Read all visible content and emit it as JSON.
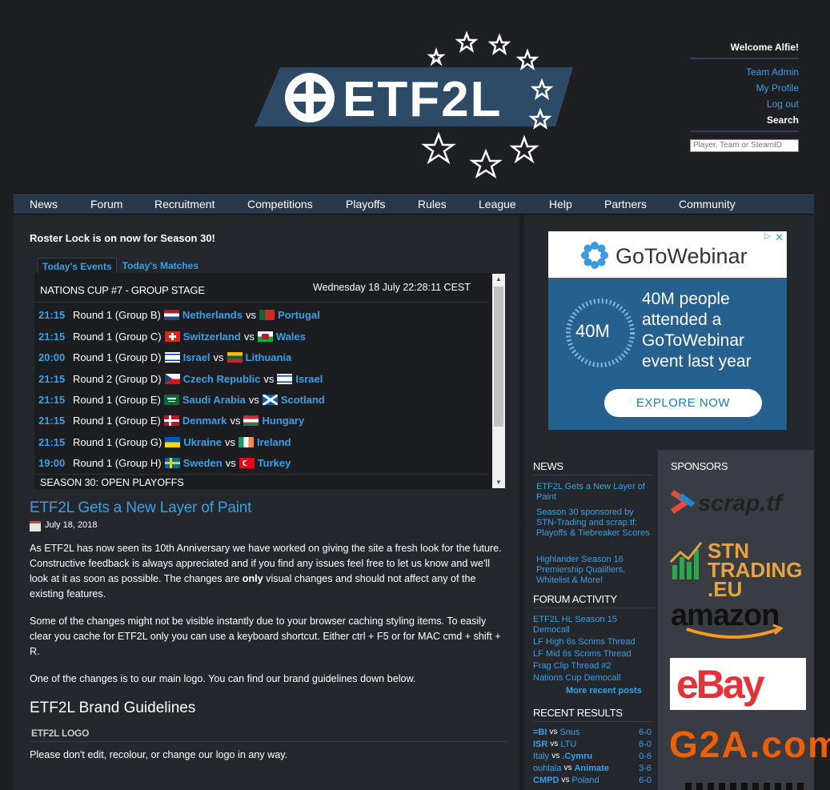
{
  "user": {
    "welcome": "Welcome Alfie!",
    "links": [
      "Team Admin",
      "My Profile",
      "Log out"
    ],
    "search_label": "Search",
    "search_placeholder": "Player, Team or SteamID"
  },
  "logo_text": "ETF2L",
  "nav": [
    "News",
    "Forum",
    "Recruitment",
    "Competitions",
    "Playoffs",
    "Rules",
    "League",
    "Help",
    "Partners",
    "Community"
  ],
  "announcement": "Roster Lock is on now for Season 30!",
  "tabs": [
    "Today's Events",
    "Today's Matches"
  ],
  "events": {
    "heading": "NATIONS CUP #7 - GROUP STAGE",
    "date": "Wednesday 18 July 22:28:11 CEST",
    "rows": [
      {
        "time": "21:15",
        "round": "Round 1 (Group B)",
        "team1": "Netherlands",
        "team2": "Portugal"
      },
      {
        "time": "21:15",
        "round": "Round 1 (Group C)",
        "team1": "Switzerland",
        "team2": "Wales"
      },
      {
        "time": "20:00",
        "round": "Round 1 (Group D)",
        "team1": "Israel",
        "team2": "Lithuania"
      },
      {
        "time": "21:15",
        "round": "Round 2 (Group D)",
        "team1": "Czech Republic",
        "team2": "Israel"
      },
      {
        "time": "21:15",
        "round": "Round 1 (Group E)",
        "team1": "Saudi Arabia",
        "team2": "Scotland"
      },
      {
        "time": "21:15",
        "round": "Round 1 (Group E)",
        "team1": "Denmark",
        "team2": "Hungary"
      },
      {
        "time": "21:15",
        "round": "Round 1 (Group G)",
        "team1": "Ukraine",
        "team2": "Ireland"
      },
      {
        "time": "19:00",
        "round": "Round 1 (Group H)",
        "team1": "Sweden",
        "team2": "Turkey"
      }
    ],
    "vs": "vs",
    "footer": "SEASON 30: OPEN PLAYOFFS"
  },
  "article": {
    "title": "ETF2L Gets a New Layer of Paint",
    "date": "July 18, 2018",
    "p1_a": "As ETF2L has now seen its 10th Anniversary we have worked on giving the site a fresh look for the future. Constructive feedback is always appreciated and if you find any issues feel free to let us know and we'll look at it as soon as possible. The changes are ",
    "p1_bold": "only",
    "p1_b": " visual changes and should not affect any of the existing features.",
    "p2": "Some of the changes might not be visible instantly due to your browser caching styling items. To easily clear you cache for ETF2L only you can use a keyboard shortcut. Either ctrl + F5 or for MAC cmd + shift + R.",
    "p3": "One of the changes is to our main logo. You can find our brand guidelines down below.",
    "brand_title": "ETF2L Brand Guidelines",
    "logo_sub": "ETF2L LOGO",
    "p4": "Please don't edit, recolour, or change our logo in any way."
  },
  "ad": {
    "brand": "GoToWebinar",
    "circle": "40M",
    "headline": "40M people attended a GoToWebinar event last year",
    "button": "EXPLORE NOW"
  },
  "news": {
    "heading": "NEWS",
    "items": [
      "ETF2L Gets a New Layer of Paint",
      "Season 30 sponsored by STN-Trading and scrap.tf: Playoffs & Tiebreaker Scores",
      "Highlander Season 16 Premiership Qualifiers, Whitelist & More!"
    ]
  },
  "forum": {
    "heading": "FORUM ACTIVITY",
    "items": [
      "ETF2L HL Season 15 Democall",
      "LF High 6s Scrims Thread",
      "LF Mid 6s Scrims Thread",
      "Frag Clip Thread #2",
      "Nations Cup Democall"
    ],
    "more": "More recent posts"
  },
  "results": {
    "heading": "RECENT RESULTS",
    "rows": [
      {
        "t1": "=BI",
        "t2": "Snus",
        "score": "6-0"
      },
      {
        "t1": "ISR",
        "t2": "LTU",
        "score": "6-0"
      },
      {
        "t1": "Italy",
        "t2": ".Cymru",
        "score": "0-6"
      },
      {
        "t1": "ouhlala",
        "t2": "Animate",
        "score": "3-6"
      },
      {
        "t1": "CMPD",
        "t2": "Poland",
        "score": "6-0"
      }
    ]
  },
  "sponsors": {
    "heading": "SPONSORS",
    "items": [
      "scrap.tf",
      "STN TRADING .EU",
      "amazon",
      "eBay",
      "G2A.com"
    ]
  }
}
